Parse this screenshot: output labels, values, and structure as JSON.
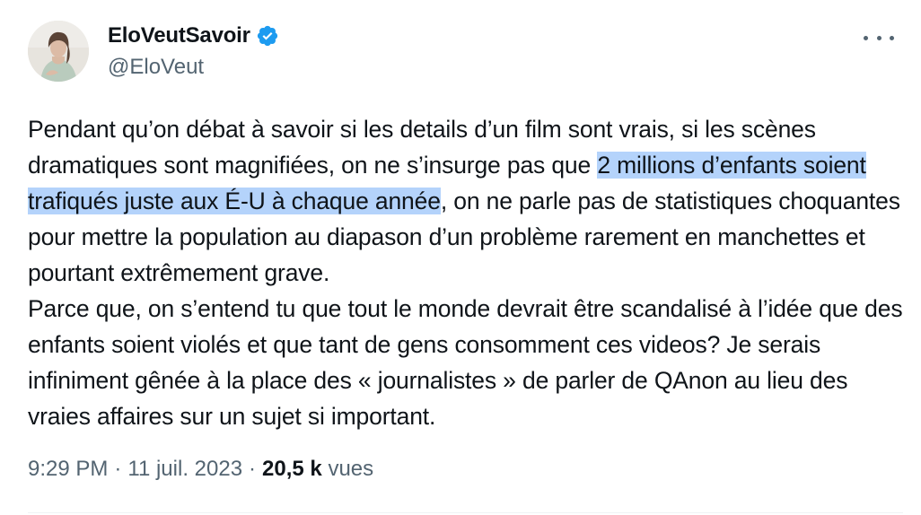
{
  "author": {
    "display_name": "EloVeutSavoir",
    "handle": "@EloVeut",
    "verified": true,
    "avatar_icon": "profile-photo"
  },
  "more_icon": "more-horizontal-icon",
  "tweet": {
    "text_before": "Pendant qu’on débat à savoir si les details d’un film sont vrais, si les scènes dramatiques sont magnifiées, on ne s’insurge pas que ",
    "text_highlighted": "2 millions d’enfants soient trafiqués juste aux É-U à chaque année",
    "text_after": ", on ne parle pas de statistiques choquantes pour mettre la population au diapason d’un problème rarement en manchettes et pourtant extrêmement grave.",
    "paragraph_2": "Parce que, on s’entend tu que tout le monde devrait être scandalisé à l’idée que des enfants soient violés et que tant de gens consomment ces videos? Je serais infiniment gênée à la place des « journalistes » de parler de QAnon au lieu des vraies affaires sur un sujet si important."
  },
  "meta": {
    "time": "9:29 PM",
    "separator": "·",
    "date": "11 juil. 2023",
    "views_count": "20,5 k",
    "views_label": "vues"
  },
  "colors": {
    "text": "#0f1419",
    "secondary": "#536471",
    "verified_badge": "#1d9bf0",
    "selection_highlight": "#b4d3fb"
  }
}
